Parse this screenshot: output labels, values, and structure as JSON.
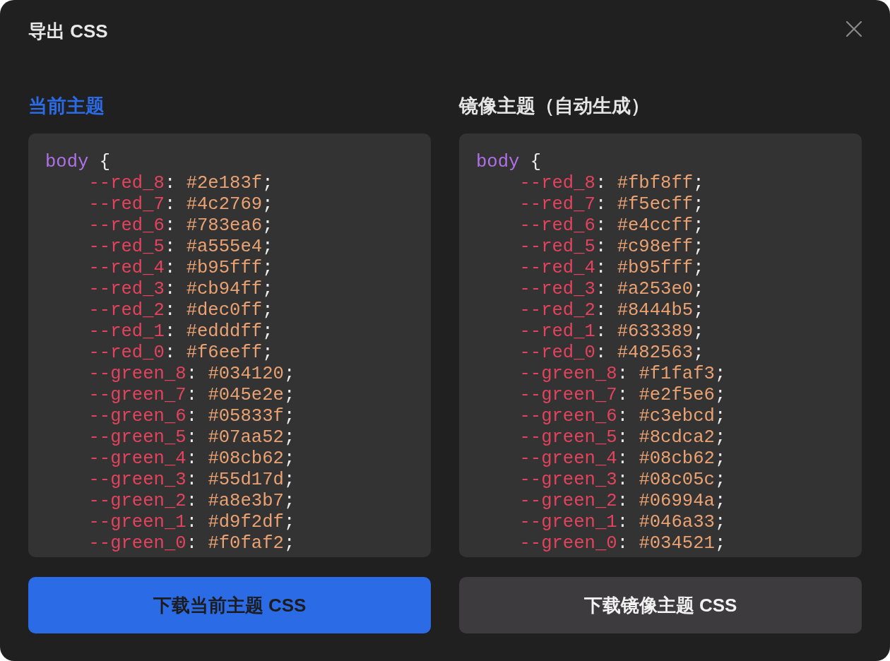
{
  "dialog": {
    "title": "导出 CSS"
  },
  "panels": [
    {
      "heading": "当前主题",
      "selected": true,
      "code": {
        "selector": "body",
        "brace": "{",
        "declarations": [
          {
            "property": "--red_8",
            "colon": ":",
            "value": "#2e183f",
            "end": ";"
          },
          {
            "property": "--red_7",
            "colon": ":",
            "value": "#4c2769",
            "end": ";"
          },
          {
            "property": "--red_6",
            "colon": ":",
            "value": "#783ea6",
            "end": ";"
          },
          {
            "property": "--red_5",
            "colon": ":",
            "value": "#a555e4",
            "end": ";"
          },
          {
            "property": "--red_4",
            "colon": ":",
            "value": "#b95fff",
            "end": ";"
          },
          {
            "property": "--red_3",
            "colon": ":",
            "value": "#cb94ff",
            "end": ";"
          },
          {
            "property": "--red_2",
            "colon": ":",
            "value": "#dec0ff",
            "end": ";"
          },
          {
            "property": "--red_1",
            "colon": ":",
            "value": "#edddff",
            "end": ";"
          },
          {
            "property": "--red_0",
            "colon": ":",
            "value": "#f6eeff",
            "end": ";"
          },
          {
            "property": "--green_8",
            "colon": ":",
            "value": "#034120",
            "end": ";"
          },
          {
            "property": "--green_7",
            "colon": ":",
            "value": "#045e2e",
            "end": ";"
          },
          {
            "property": "--green_6",
            "colon": ":",
            "value": "#05833f",
            "end": ";"
          },
          {
            "property": "--green_5",
            "colon": ":",
            "value": "#07aa52",
            "end": ";"
          },
          {
            "property": "--green_4",
            "colon": ":",
            "value": "#08cb62",
            "end": ";"
          },
          {
            "property": "--green_3",
            "colon": ":",
            "value": "#55d17d",
            "end": ";"
          },
          {
            "property": "--green_2",
            "colon": ":",
            "value": "#a8e3b7",
            "end": ";"
          },
          {
            "property": "--green_1",
            "colon": ":",
            "value": "#d9f2df",
            "end": ";"
          },
          {
            "property": "--green_0",
            "colon": ":",
            "value": "#f0faf2",
            "end": ";"
          }
        ]
      },
      "button": {
        "label": "下载当前主题 CSS"
      }
    },
    {
      "heading": "镜像主题（自动生成）",
      "selected": false,
      "code": {
        "selector": "body",
        "brace": "{",
        "declarations": [
          {
            "property": "--red_8",
            "colon": ":",
            "value": "#fbf8ff",
            "end": ";"
          },
          {
            "property": "--red_7",
            "colon": ":",
            "value": "#f5ecff",
            "end": ";"
          },
          {
            "property": "--red_6",
            "colon": ":",
            "value": "#e4ccff",
            "end": ";"
          },
          {
            "property": "--red_5",
            "colon": ":",
            "value": "#c98eff",
            "end": ";"
          },
          {
            "property": "--red_4",
            "colon": ":",
            "value": "#b95fff",
            "end": ";"
          },
          {
            "property": "--red_3",
            "colon": ":",
            "value": "#a253e0",
            "end": ";"
          },
          {
            "property": "--red_2",
            "colon": ":",
            "value": "#8444b5",
            "end": ";"
          },
          {
            "property": "--red_1",
            "colon": ":",
            "value": "#633389",
            "end": ";"
          },
          {
            "property": "--red_0",
            "colon": ":",
            "value": "#482563",
            "end": ";"
          },
          {
            "property": "--green_8",
            "colon": ":",
            "value": "#f1faf3",
            "end": ";"
          },
          {
            "property": "--green_7",
            "colon": ":",
            "value": "#e2f5e6",
            "end": ";"
          },
          {
            "property": "--green_6",
            "colon": ":",
            "value": "#c3ebcd",
            "end": ";"
          },
          {
            "property": "--green_5",
            "colon": ":",
            "value": "#8cdca2",
            "end": ";"
          },
          {
            "property": "--green_4",
            "colon": ":",
            "value": "#08cb62",
            "end": ";"
          },
          {
            "property": "--green_3",
            "colon": ":",
            "value": "#08c05c",
            "end": ";"
          },
          {
            "property": "--green_2",
            "colon": ":",
            "value": "#06994a",
            "end": ";"
          },
          {
            "property": "--green_1",
            "colon": ":",
            "value": "#046a33",
            "end": ";"
          },
          {
            "property": "--green_0",
            "colon": ":",
            "value": "#034521",
            "end": ";"
          }
        ]
      },
      "button": {
        "label": "下载镜像主题 CSS"
      }
    }
  ]
}
